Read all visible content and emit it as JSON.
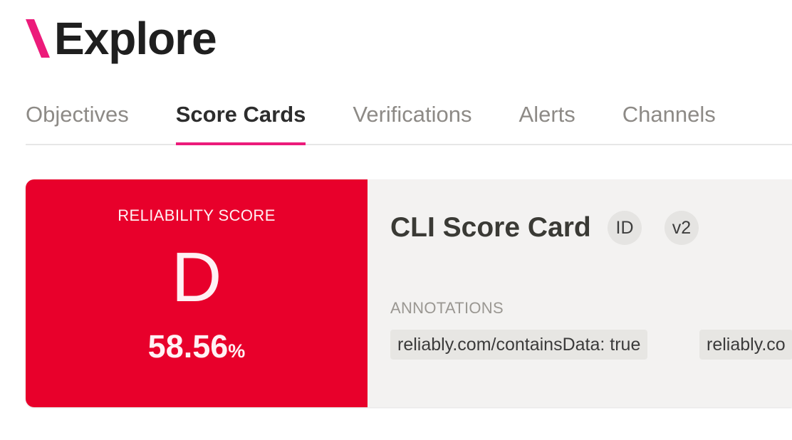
{
  "brand": {
    "accent": "#ec1b7a",
    "title": "Explore"
  },
  "tabs": [
    {
      "label": "Objectives",
      "active": false
    },
    {
      "label": "Score Cards",
      "active": true
    },
    {
      "label": "Verifications",
      "active": false
    },
    {
      "label": "Alerts",
      "active": false
    },
    {
      "label": "Channels",
      "active": false
    }
  ],
  "scorecard": {
    "score_label": "RELIABILITY SCORE",
    "grade": "D",
    "percentage_value": "58.56",
    "percentage_symbol": "%",
    "status_color": "#e8002b",
    "title": "CLI Score Card",
    "pills": {
      "id": "ID",
      "version": "v2"
    },
    "annotations_label": "ANNOTATIONS",
    "annotations": [
      "reliably.com/containsData: true",
      "reliably.co"
    ]
  }
}
